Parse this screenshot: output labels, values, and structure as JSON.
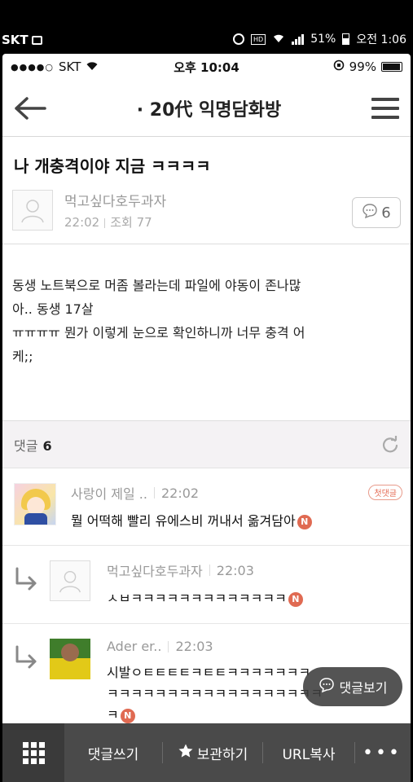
{
  "android_status": {
    "carrier": "SKT",
    "battery": "51%",
    "time_label": "오전 1:06",
    "hd_label": "HD"
  },
  "ios_status": {
    "signal_dots": "●●●●○",
    "carrier": "SKT",
    "time": "오후 10:04",
    "battery": "99%"
  },
  "header": {
    "title": "· 20代 익명담화방"
  },
  "post": {
    "title": "나 개충격이야 지금 ㅋㅋㅋㅋ",
    "author": "먹고싶다호두과자",
    "time": "22:02",
    "views": "조회 77",
    "comment_count": "6",
    "body_lines": [
      "동생 노트북으로 머좀 볼라는데 파일에 야동이 존나많",
      "아.. 동생 17살",
      "ㅠㅠㅠㅠ 뭔가 이렇게 눈으로 확인하니까 너무 충격 어",
      "케;;"
    ]
  },
  "comments_header": {
    "label": "댓글",
    "count": "6"
  },
  "comments": [
    {
      "author": "사랑이 제일 ..",
      "time": "22:02",
      "badge": "첫댓글",
      "text": "뭘 어떡해 빨리 유에스비 꺼내서 옮겨담아",
      "new_badge": "N"
    },
    {
      "author": "먹고싶다호두과자",
      "time": "22:03",
      "text": "ㅅㅂㅋㅋㅋㅋㅋㅋㅋㅋㅋㅋㅋㅋㅋ",
      "new_badge": "N"
    },
    {
      "author": "Ader er..",
      "time": "22:03",
      "text_lines": [
        "시발ㅇㅌㅌㅌㅌㅋㅌㅌㅋㅋㅋㅋㅋㅋㅋ",
        "ㅋㅋㅋㅋㅋㅋㅋㅋㅋㅋㅋㅋㅋㅋㅋㅋㅋㅋ",
        "ㅋ"
      ],
      "new_badge": "N"
    }
  ],
  "floating_button": {
    "label": "댓글보기"
  },
  "bottom_bar": {
    "write_comment": "댓글쓰기",
    "save": "보관하기",
    "copy_url": "URL복사",
    "more": "•••"
  }
}
